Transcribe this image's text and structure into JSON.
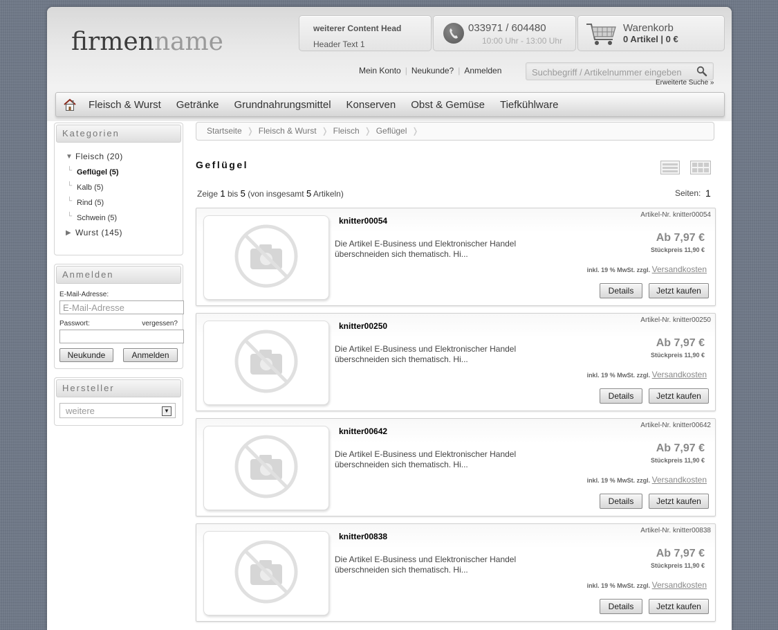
{
  "header": {
    "logo_dark": "firmen",
    "logo_light": "name",
    "content_head_title": "weiterer Content Head",
    "content_head_text": "Header Text 1",
    "phone": "033971 / 604480",
    "hours": "10:00 Uhr - 13:00 Uhr",
    "cart_title": "Warenkorb",
    "cart_summary": "0 Artikel | 0 €",
    "links": [
      "Mein Konto",
      "Neukunde?",
      "Anmelden"
    ],
    "search_placeholder": "Suchbegriff / Artikelnummer eingeben",
    "advanced_search": "Erweiterte Suche »"
  },
  "nav": {
    "items": [
      "Fleisch & Wurst",
      "Getränke",
      "Grundnahrungsmittel",
      "Konserven",
      "Obst & Gemüse",
      "Tiefkühlware"
    ]
  },
  "sidebar": {
    "categories_title": "Kategorien",
    "categories": [
      {
        "label": "Fleisch",
        "count": "(20)"
      },
      {
        "label": "Geflügel",
        "count": "(5)"
      },
      {
        "label": "Kalb",
        "count": "(5)"
      },
      {
        "label": "Rind",
        "count": "(5)"
      },
      {
        "label": "Schwein",
        "count": "(5)"
      },
      {
        "label": "Wurst",
        "count": "(145)"
      }
    ],
    "login_title": "Anmelden",
    "email_label": "E-Mail-Adresse:",
    "email_placeholder": "E-Mail-Adresse",
    "password_label": "Passwort:",
    "forgot": "vergessen?",
    "new_customer_btn": "Neukunde",
    "login_btn": "Anmelden",
    "manufacturer_title": "Hersteller",
    "manufacturer_selected": "weitere"
  },
  "breadcrumb": [
    "Startseite",
    "Fleisch & Wurst",
    "Fleisch",
    "Geflügel"
  ],
  "listing": {
    "title": "Geflügel",
    "count_prefix": "Zeige",
    "count_from": "1",
    "count_mid": "bis",
    "count_to": "5",
    "count_suffix_a": "(von insgesamt",
    "count_total": "5",
    "count_suffix_b": "Artikeln)",
    "pages_label": "Seiten:",
    "pages_current": "1"
  },
  "products": [
    {
      "name": "knitter00054",
      "artnr": "Artikel-Nr. knitter00054",
      "desc": "Die Artikel E-Business und Elektronischer Handel überschneiden sich thematisch. Hi...",
      "price": "Ab 7,97 €",
      "unit_price": "Stückpreis 11,90 €",
      "tax": "inkl. 19 % MwSt. zzgl.",
      "shipping": "Versandkosten",
      "details": "Details",
      "buy": "Jetzt kaufen"
    },
    {
      "name": "knitter00250",
      "artnr": "Artikel-Nr. knitter00250",
      "desc": "Die Artikel E-Business und Elektronischer Handel überschneiden sich thematisch. Hi...",
      "price": "Ab 7,97 €",
      "unit_price": "Stückpreis 11,90 €",
      "tax": "inkl. 19 % MwSt. zzgl.",
      "shipping": "Versandkosten",
      "details": "Details",
      "buy": "Jetzt kaufen"
    },
    {
      "name": "knitter00642",
      "artnr": "Artikel-Nr. knitter00642",
      "desc": "Die Artikel E-Business und Elektronischer Handel überschneiden sich thematisch. Hi...",
      "price": "Ab 7,97 €",
      "unit_price": "Stückpreis 11,90 €",
      "tax": "inkl. 19 % MwSt. zzgl.",
      "shipping": "Versandkosten",
      "details": "Details",
      "buy": "Jetzt kaufen"
    },
    {
      "name": "knitter00838",
      "artnr": "Artikel-Nr. knitter00838",
      "desc": "Die Artikel E-Business und Elektronischer Handel überschneiden sich thematisch. Hi...",
      "price": "Ab 7,97 €",
      "unit_price": "Stückpreis 11,90 €",
      "tax": "inkl. 19 % MwSt. zzgl.",
      "shipping": "Versandkosten",
      "details": "Details",
      "buy": "Jetzt kaufen"
    }
  ],
  "icons": {
    "home": "home-icon",
    "phone": "phone-icon",
    "cart": "cart-icon",
    "search": "search-icon",
    "list_view": "list-view-icon",
    "grid_view": "grid-view-icon",
    "no_image": "no-image-icon"
  },
  "colors": {
    "background": "#6f7887",
    "text": "#333333",
    "muted": "#888888"
  }
}
